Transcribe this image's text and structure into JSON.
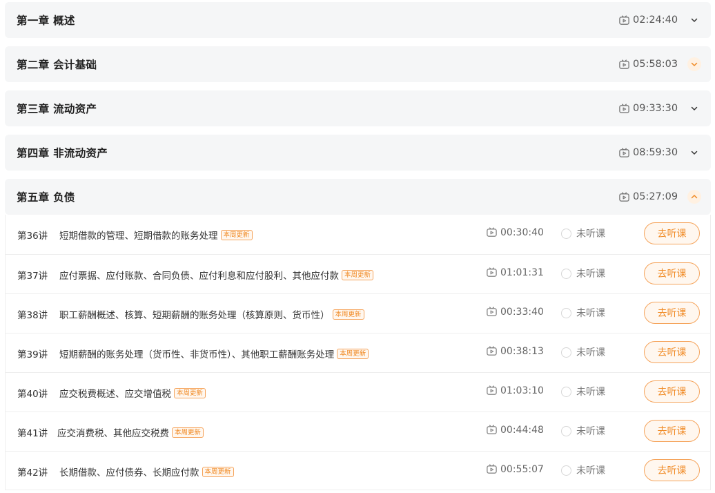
{
  "chapters": [
    {
      "title": "第一章 概述",
      "duration": "02:24:40",
      "expanded": false
    },
    {
      "title": "第二章 会计基础",
      "duration": "05:58:03",
      "expanded": false
    },
    {
      "title": "第三章 流动资产",
      "duration": "09:33:30",
      "expanded": false
    },
    {
      "title": "第四章 非流动资产",
      "duration": "08:59:30",
      "expanded": false
    },
    {
      "title": "第五章 负债",
      "duration": "05:27:09",
      "expanded": true
    }
  ],
  "lessons": [
    {
      "num": "第36讲",
      "title": "短期借款的管理、短期借款的账务处理",
      "badge": "本周更新",
      "duration": "00:30:40",
      "status": "未听课",
      "button": "去听课"
    },
    {
      "num": "第37讲",
      "title": "应付票据、应付账款、合同负债、应付利息和应付股利、其他应付款",
      "badge": "本周更新",
      "duration": "01:01:31",
      "status": "未听课",
      "button": "去听课"
    },
    {
      "num": "第38讲",
      "title": "职工薪酬概述、核算、短期薪酬的账务处理（核算原则、货币性）",
      "badge": "本周更新",
      "duration": "00:33:40",
      "status": "未听课",
      "button": "去听课"
    },
    {
      "num": "第39讲",
      "title": "短期薪酬的账务处理（货币性、非货币性）、其他职工薪酬账务处理",
      "badge": "本周更新",
      "duration": "00:38:13",
      "status": "未听课",
      "button": "去听课"
    },
    {
      "num": "第40讲",
      "title": "应交税费概述、应交增值税",
      "badge": "本周更新",
      "duration": "01:03:10",
      "status": "未听课",
      "button": "去听课"
    },
    {
      "num": "第41讲",
      "title": "应交消费税、其他应交税费",
      "badge": "本周更新",
      "duration": "00:44:48",
      "status": "未听课",
      "button": "去听课"
    },
    {
      "num": "第42讲",
      "title": "长期借款、应付债券、长期应付款",
      "badge": "本周更新",
      "duration": "00:55:07",
      "status": "未听课",
      "button": "去听课"
    }
  ],
  "colors": {
    "accent": "#f08a24",
    "accent_border": "#f5a35a",
    "chapter_bg": "#f5f6f7"
  }
}
